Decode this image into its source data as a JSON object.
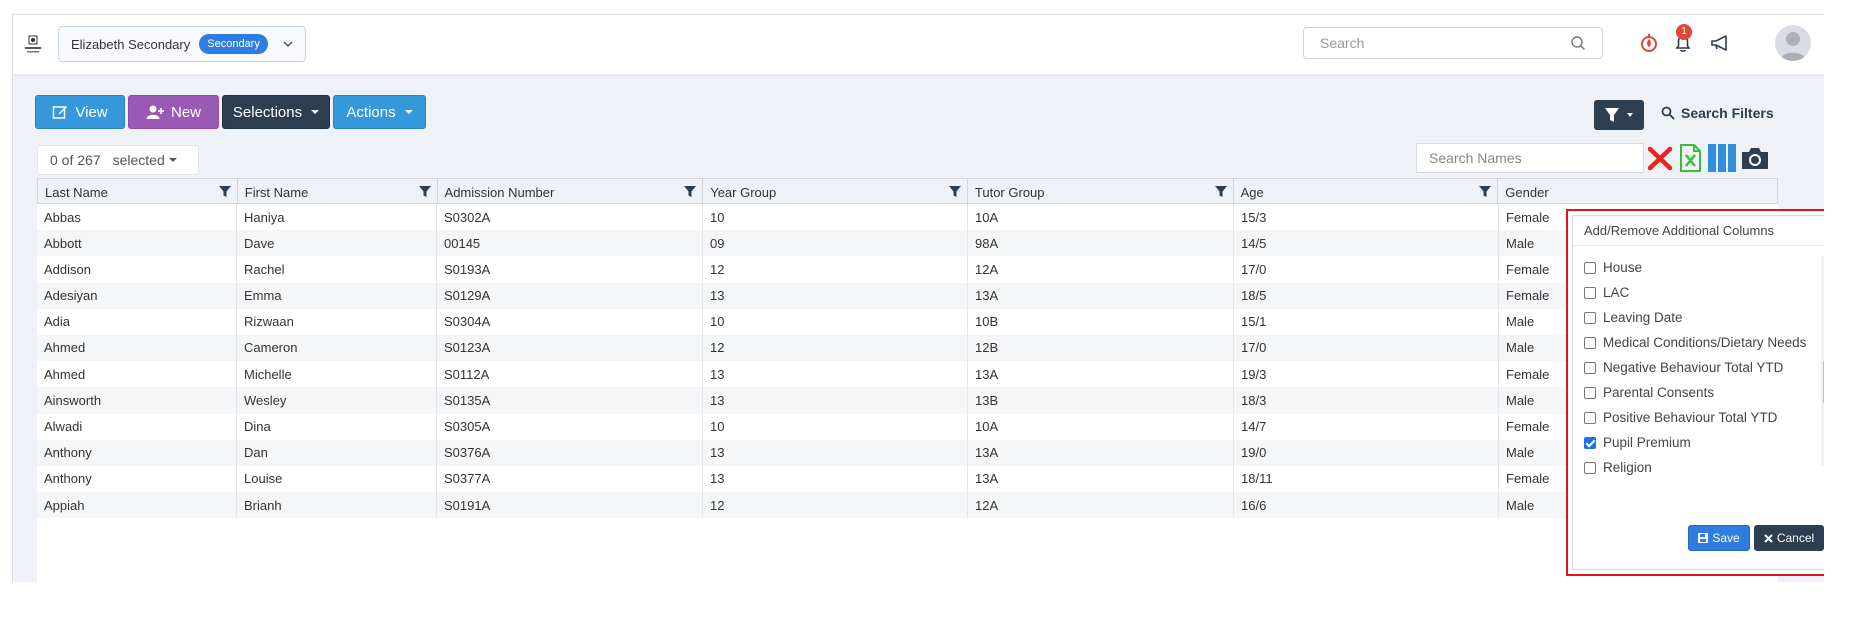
{
  "school": {
    "name": "Elizabeth Secondary",
    "phase": "Secondary"
  },
  "top_search": {
    "placeholder": "Search"
  },
  "notifications": {
    "count": "1"
  },
  "toolbar": {
    "view": "View",
    "new": "New",
    "selections": "Selections",
    "actions": "Actions"
  },
  "search_filters": "Search Filters",
  "selection": {
    "count": "0 of 267",
    "label": "selected"
  },
  "names_search": {
    "placeholder": "Search Names"
  },
  "table": {
    "headers": [
      "Last Name",
      "First Name",
      "Admission Number",
      "Year Group",
      "Tutor Group",
      "Age",
      "Gender"
    ],
    "rows": [
      [
        "Abbas",
        "Haniya",
        "S0302A",
        "10",
        "10A",
        "15/3",
        "Female"
      ],
      [
        "Abbott",
        "Dave",
        "00145",
        "09",
        "98A",
        "14/5",
        "Male"
      ],
      [
        "Addison",
        "Rachel",
        "S0193A",
        "12",
        "12A",
        "17/0",
        "Female"
      ],
      [
        "Adesiyan",
        "Emma",
        "S0129A",
        "13",
        "13A",
        "18/5",
        "Female"
      ],
      [
        "Adia",
        "Rizwaan",
        "S0304A",
        "10",
        "10B",
        "15/1",
        "Male"
      ],
      [
        "Ahmed",
        "Cameron",
        "S0123A",
        "12",
        "12B",
        "17/0",
        "Male"
      ],
      [
        "Ahmed",
        "Michelle",
        "S0112A",
        "13",
        "13A",
        "19/3",
        "Female"
      ],
      [
        "Ainsworth",
        "Wesley",
        "S0135A",
        "13",
        "13B",
        "18/3",
        "Male"
      ],
      [
        "Alwadi",
        "Dina",
        "S0305A",
        "10",
        "10A",
        "14/7",
        "Female"
      ],
      [
        "Anthony",
        "Dan",
        "S0376A",
        "13",
        "13A",
        "19/0",
        "Male"
      ],
      [
        "Anthony",
        "Louise",
        "S0377A",
        "13",
        "13A",
        "18/11",
        "Female"
      ],
      [
        "Appiah",
        "Brianh",
        "S0191A",
        "12",
        "12A",
        "16/6",
        "Male"
      ]
    ]
  },
  "column_panel": {
    "title": "Add/Remove Additional Columns",
    "options": [
      {
        "label": "House",
        "checked": false
      },
      {
        "label": "LAC",
        "checked": false
      },
      {
        "label": "Leaving Date",
        "checked": false
      },
      {
        "label": "Medical Conditions/Dietary Needs",
        "checked": false
      },
      {
        "label": "Negative Behaviour Total YTD",
        "checked": false
      },
      {
        "label": "Parental Consents",
        "checked": false
      },
      {
        "label": "Positive Behaviour Total YTD",
        "checked": false
      },
      {
        "label": "Pupil Premium",
        "checked": true
      },
      {
        "label": "Religion",
        "checked": false
      }
    ],
    "save": "Save",
    "cancel": "Cancel"
  }
}
